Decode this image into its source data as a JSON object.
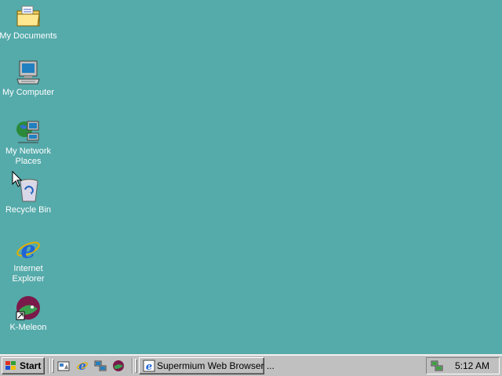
{
  "desktop": {
    "background_color": "#55aaaa",
    "icons": [
      {
        "label": "My Documents",
        "icon": "folder-documents-icon"
      },
      {
        "label": "My Computer",
        "icon": "computer-icon"
      },
      {
        "label": "My Network Places",
        "icon": "network-places-icon"
      },
      {
        "label": "Recycle Bin",
        "icon": "recycle-bin-icon"
      },
      {
        "label": "Internet Explorer",
        "icon": "internet-explorer-icon"
      },
      {
        "label": "K-Meleon",
        "icon": "k-meleon-icon"
      }
    ]
  },
  "taskbar": {
    "start_label": "Start",
    "quick_launch": [
      {
        "icon": "show-desktop-icon"
      },
      {
        "icon": "internet-explorer-icon"
      },
      {
        "icon": "network-connections-icon"
      },
      {
        "icon": "k-meleon-icon"
      }
    ],
    "tasks": [
      {
        "label": "Supermium Web Browser ...",
        "icon": "supermium-icon"
      }
    ],
    "tray": {
      "icons": [
        {
          "icon": "network-status-icon"
        }
      ],
      "clock": "5:12 AM"
    }
  }
}
